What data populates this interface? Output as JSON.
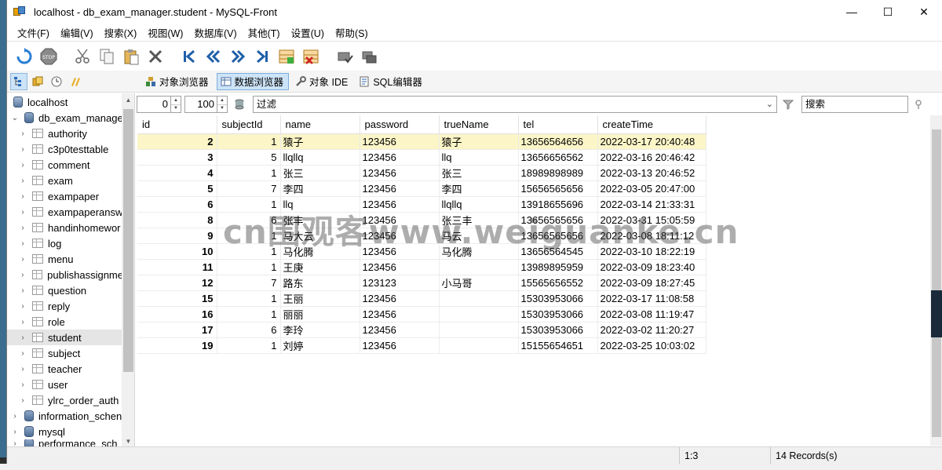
{
  "window": {
    "title": "localhost - db_exam_manager.student - MySQL-Front",
    "minimize": "—",
    "maximize": "☐",
    "close": "✕"
  },
  "menu": [
    "文件(F)",
    "编辑(V)",
    "搜索(X)",
    "视图(W)",
    "数据库(V)",
    "其他(T)",
    "设置(U)",
    "帮助(S)"
  ],
  "views": {
    "object_browser": "对象浏览器",
    "data_browser": "数据浏览器",
    "object_ide": "对象 IDE",
    "sql_editor": "SQL编辑器"
  },
  "tree": {
    "host": "localhost",
    "database": "db_exam_manage",
    "tables": [
      "authority",
      "c3p0testtable",
      "comment",
      "exam",
      "exampaper",
      "exampaperansw",
      "handinhomewor",
      "log",
      "menu",
      "publishassignme",
      "question",
      "reply",
      "role",
      "student",
      "subject",
      "teacher",
      "user",
      "ylrc_order_auth"
    ],
    "selected_table": "student",
    "other_dbs": [
      "information_schen",
      "mysql",
      "performance_sch"
    ]
  },
  "filter": {
    "offset": "0",
    "limit": "100",
    "filter_placeholder": "过滤",
    "search_placeholder": "搜索"
  },
  "grid": {
    "columns": [
      "id",
      "subjectId",
      "name",
      "password",
      "trueName",
      "tel",
      "createTime"
    ],
    "rows": [
      [
        "2",
        "1",
        "猿子",
        "123456",
        "猿子",
        "13656564656",
        "2022-03-17 20:40:48"
      ],
      [
        "3",
        "5",
        "llqllq",
        "123456",
        "llq",
        "13656656562",
        "2022-03-16 20:46:42"
      ],
      [
        "4",
        "1",
        "张三",
        "123456",
        "张三",
        "18989898989",
        "2022-03-13 20:46:52"
      ],
      [
        "5",
        "7",
        "李四",
        "123456",
        "李四",
        "15656565656",
        "2022-03-05 20:47:00"
      ],
      [
        "6",
        "1",
        "llq",
        "123456",
        "llqllq",
        "13918655696",
        "2022-03-14 21:33:31"
      ],
      [
        "8",
        "6",
        "张丰",
        "123456",
        "张三丰",
        "13656565656",
        "2022-03-31 15:05:59"
      ],
      [
        "9",
        "1",
        "马大云",
        "123456",
        "马云",
        "13656565656",
        "2022-03-08 18:11:12"
      ],
      [
        "10",
        "1",
        "马化腾",
        "123456",
        "马化腾",
        "13656564545",
        "2022-03-10 18:22:19"
      ],
      [
        "11",
        "1",
        "王庚",
        "123456",
        "",
        "13989895959",
        "2022-03-09 18:23:40"
      ],
      [
        "12",
        "7",
        "路东",
        "123123",
        "小马哥",
        "15565656552",
        "2022-03-09 18:27:45"
      ],
      [
        "15",
        "1",
        "王丽",
        "123456",
        "",
        "15303953066",
        "2022-03-17 11:08:58"
      ],
      [
        "16",
        "1",
        "丽丽",
        "123456",
        "",
        "15303953066",
        "2022-03-08 11:19:47"
      ],
      [
        "17",
        "6",
        "李玲",
        "123456",
        "",
        "15303953066",
        "2022-03-02 11:20:27"
      ],
      [
        "19",
        "1",
        "刘婷",
        "123456",
        "",
        "15155654651",
        "2022-03-25 10:03:02"
      ]
    ],
    "selected_row": 0
  },
  "status": {
    "position": "1:3",
    "records": "14 Records(s)"
  },
  "watermark": "cn围观客www.weiguanke.cn",
  "colors": {
    "selected_row": "#fbf5c7",
    "active_tab": "#cde3f7"
  }
}
